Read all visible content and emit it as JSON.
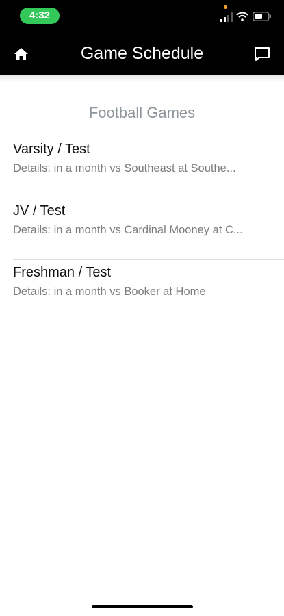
{
  "status_bar": {
    "time": "4:32"
  },
  "nav": {
    "title": "Game Schedule",
    "left_icon": "home-icon",
    "right_icon": "chat-bubble-icon"
  },
  "section": {
    "header": "Football Games"
  },
  "games": [
    {
      "title": "Varsity / Test",
      "details": "Details: in a month vs Southeast at Southe..."
    },
    {
      "title": "JV / Test",
      "details": "Details: in a month vs Cardinal Mooney at C..."
    },
    {
      "title": "Freshman / Test",
      "details": "Details: in a month vs Booker at Home"
    }
  ],
  "colors": {
    "nav_background": "#000000",
    "time_pill": "#34c759",
    "section_header": "#8c969b",
    "details_text": "#7c7c7c"
  }
}
